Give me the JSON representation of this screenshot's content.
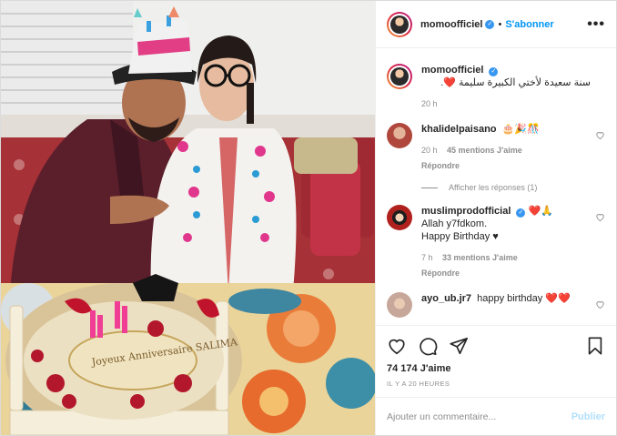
{
  "post": {
    "author": "momoofficiel",
    "follow_label": "S'abonner",
    "separator": "•",
    "more_label": "•••",
    "caption_user": "momoofficiel",
    "caption_text": "سنة سعيدة لأختي الكبيرة سليمة ❤️.",
    "caption_time": "20 h",
    "photo_text": "Joyeux Anniversaire SALIMA"
  },
  "comments": [
    {
      "user": "khalidelpaisano",
      "text": "🎂🎉🎊",
      "time": "20 h",
      "likes": "45 mentions J'aime",
      "reply": "Répondre",
      "avatar_color": "#b0473c"
    },
    {
      "user": "muslimprodofficial",
      "text_line1": "❤️🙏",
      "text_line2": "Allah y7fdkom.",
      "text_line3": "Happy Birthday ♥",
      "time": "7 h",
      "likes": "33 mentions J'aime",
      "reply": "Répondre",
      "avatar_color": "#b0201c"
    },
    {
      "user": "ayo_ub.jr7",
      "text": "happy birthday ❤️❤️",
      "avatar_color": "#c7a79a"
    }
  ],
  "view_replies": "Afficher les réponses (1)",
  "likes_count": "74 174 J'aime",
  "timestamp": "IL Y A 20 HEURES",
  "add_comment": {
    "placeholder": "Ajouter un commentaire...",
    "publish_label": "Publier"
  },
  "colors": {
    "accent_blue": "#0095f6",
    "verified_blue": "#3897f0",
    "muted": "#8e8e8e",
    "publish_disabled": "#b2dffc"
  }
}
